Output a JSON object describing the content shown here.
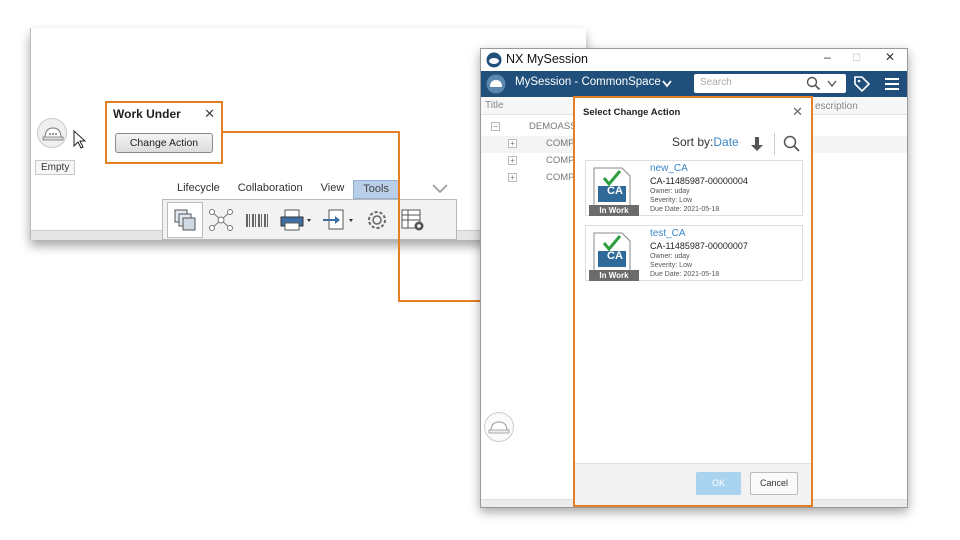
{
  "left_window": {
    "empty_label": "Empty",
    "work_under": {
      "title": "Work Under",
      "close": "✕",
      "button_label": "Change Action"
    },
    "ribbon_tabs": [
      "Lifecycle",
      "Collaboration",
      "View",
      "Tools"
    ],
    "active_tab": "Tools"
  },
  "right_window": {
    "app_title": "NX MySession",
    "window_controls": {
      "minimize": "–",
      "maximize": "□",
      "close": "✕"
    },
    "session_label": "MySession - CommonSpace",
    "search_placeholder": "Search",
    "grid_header": {
      "title": "Title",
      "description": "escription"
    },
    "tree_rows": [
      "DEMOASS",
      "COMP",
      "COMP",
      "COMP"
    ]
  },
  "dialog": {
    "title": "Select Change Action",
    "close": "✕",
    "sort_prefix": "Sort by:",
    "sort_value": "Date",
    "cards": [
      {
        "name": "new_CA",
        "id": "CA-11485987-00000004",
        "owner": "Owner: uday",
        "severity": "Severity: Low",
        "due": "Due Date: 2021-05-18",
        "badge": "In Work",
        "thumb_text": "CA"
      },
      {
        "name": "test_CA",
        "id": "CA-11485987-00000007",
        "owner": "Owner: uday",
        "severity": "Severity: Low",
        "due": "Due Date: 2021-05-18",
        "badge": "In Work",
        "thumb_text": "CA"
      }
    ],
    "ok_label": "OK",
    "cancel_label": "Cancel"
  },
  "colors": {
    "highlight": "#e67e22",
    "header_blue": "#1f4f7a",
    "link_blue": "#3a86c8",
    "ok_blue": "#a9d3ef"
  }
}
